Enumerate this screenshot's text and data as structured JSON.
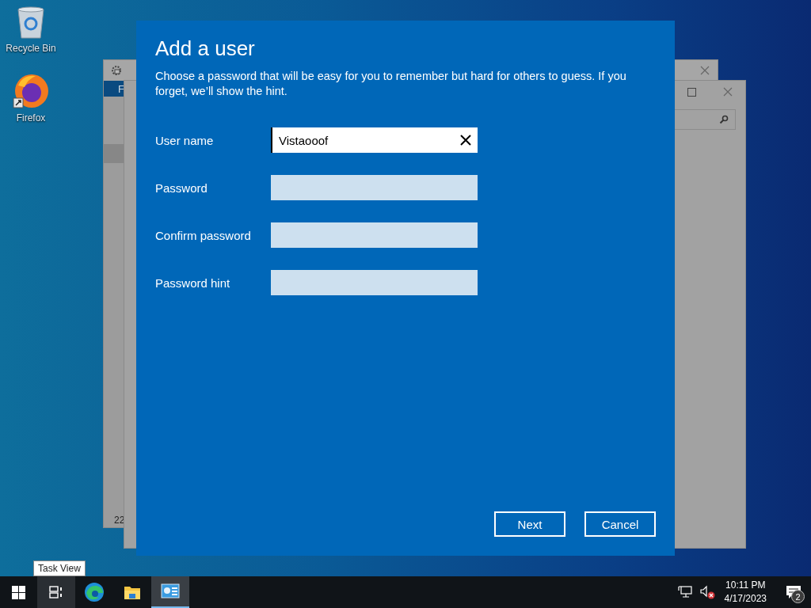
{
  "desktop": {
    "icons": [
      {
        "label": "Recycle Bin",
        "kind": "recycle-bin"
      },
      {
        "label": "Firefox",
        "kind": "firefox"
      }
    ]
  },
  "background_window": {
    "ribbon_tab": "F",
    "footer_text": "22"
  },
  "dialog": {
    "title": "Add a user",
    "description": "Choose a password that will be easy for you to remember but hard for others to guess. If you forget, we’ll show the hint.",
    "fields": [
      {
        "label": "User name",
        "value": "Vistaooof"
      },
      {
        "label": "Password"
      },
      {
        "label": "Confirm password"
      },
      {
        "label": "Password hint"
      }
    ],
    "buttons": [
      {
        "label": "Next"
      },
      {
        "label": "Cancel"
      }
    ]
  },
  "tooltip": "Task View",
  "taskbar": {
    "apps": [
      {
        "kind": "task-view",
        "selected": false
      },
      {
        "kind": "edge",
        "selected": false
      },
      {
        "kind": "explorer",
        "selected": false
      },
      {
        "kind": "control-panel",
        "selected": true
      }
    ],
    "time": "10:11 PM",
    "date": "4/17/2023",
    "notification_count": "2"
  }
}
